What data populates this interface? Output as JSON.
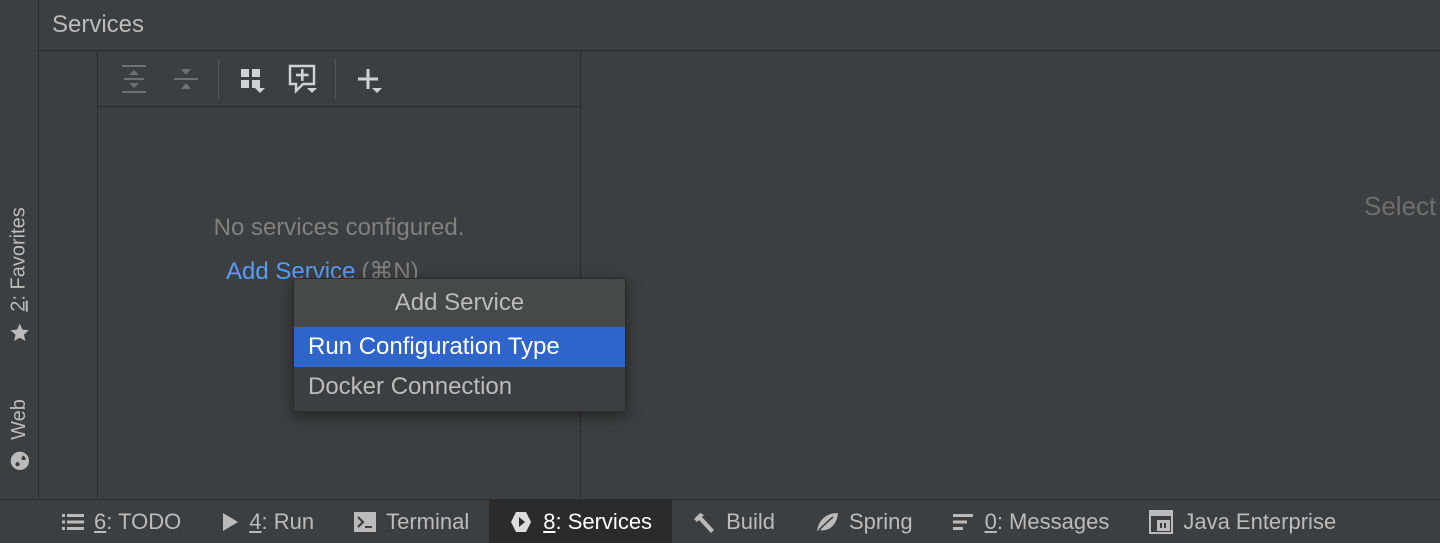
{
  "window": {
    "title": "Services"
  },
  "left_stripe": {
    "favorites_mnemonic": "2",
    "favorites_label": ": Favorites",
    "web_label": "Web"
  },
  "toolbar": {
    "buttons": [
      "expand-all-icon",
      "collapse-all-icon",
      "group-by-icon",
      "new-target-icon",
      "add-icon"
    ]
  },
  "tree": {
    "empty_text": "No services configured.",
    "add_service_link": "Add Service",
    "add_service_shortcut": "(⌘N)"
  },
  "detail": {
    "hint": "Select"
  },
  "popup": {
    "title": "Add Service",
    "items": [
      {
        "label": "Run Configuration Type",
        "selected": true
      },
      {
        "label": "Docker Connection",
        "selected": false
      }
    ]
  },
  "bottom_tabs": [
    {
      "mnemonic": "6",
      "label": ": TODO",
      "icon": "todo-list-icon",
      "active": false
    },
    {
      "mnemonic": "4",
      "label": ": Run",
      "icon": "run-icon",
      "active": false
    },
    {
      "mnemonic": "",
      "label": "Terminal",
      "icon": "terminal-icon",
      "active": false
    },
    {
      "mnemonic": "8",
      "label": ": Services",
      "icon": "services-icon",
      "active": true
    },
    {
      "mnemonic": "",
      "label": "Build",
      "icon": "hammer-icon",
      "active": false
    },
    {
      "mnemonic": "",
      "label": "Spring",
      "icon": "spring-leaf-icon",
      "active": false
    },
    {
      "mnemonic": "0",
      "label": ": Messages",
      "icon": "messages-icon",
      "active": false
    },
    {
      "mnemonic": "",
      "label": "Java Enterprise",
      "icon": "java-enterprise-icon",
      "active": false
    }
  ],
  "colors": {
    "background": "#3c3f41",
    "link": "#589df6",
    "selection": "#2f65ca"
  }
}
